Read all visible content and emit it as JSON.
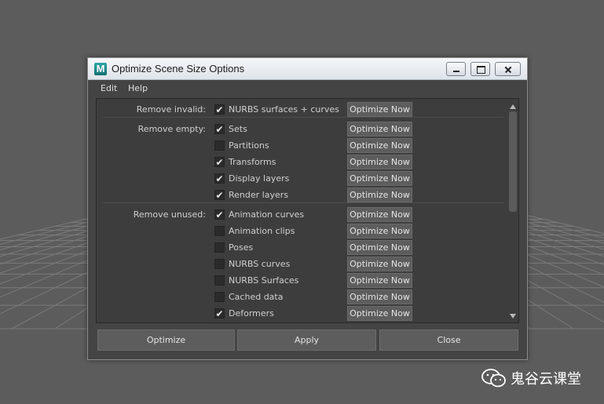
{
  "window": {
    "title": "Optimize Scene Size Options",
    "app_icon_letter": "M"
  },
  "menu": [
    "Edit",
    "Help"
  ],
  "optimize_now_label": "Optimize Now",
  "groups": [
    {
      "label": "Remove invalid:",
      "items": [
        {
          "label": "NURBS surfaces + curves",
          "checked": true
        }
      ]
    },
    {
      "label": "Remove empty:",
      "items": [
        {
          "label": "Sets",
          "checked": true
        },
        {
          "label": "Partitions",
          "checked": false
        },
        {
          "label": "Transforms",
          "checked": true
        },
        {
          "label": "Display layers",
          "checked": true
        },
        {
          "label": "Render layers",
          "checked": true
        }
      ]
    },
    {
      "label": "Remove unused:",
      "items": [
        {
          "label": "Animation curves",
          "checked": true
        },
        {
          "label": "Animation clips",
          "checked": false
        },
        {
          "label": "Poses",
          "checked": false
        },
        {
          "label": "NURBS curves",
          "checked": false
        },
        {
          "label": "NURBS Surfaces",
          "checked": false
        },
        {
          "label": "Cached data",
          "checked": false
        },
        {
          "label": "Deformers",
          "checked": true
        }
      ]
    }
  ],
  "buttons": {
    "optimize": "Optimize",
    "apply": "Apply",
    "close": "Close"
  },
  "watermark": {
    "text": "鬼谷云课堂",
    "icon": "wechat-icon"
  },
  "colors": {
    "background": "#5c5c5c",
    "grid": "#7a7a7a",
    "panel": "#444444",
    "list": "#3d3d3d",
    "button": "#5d5d5d"
  }
}
